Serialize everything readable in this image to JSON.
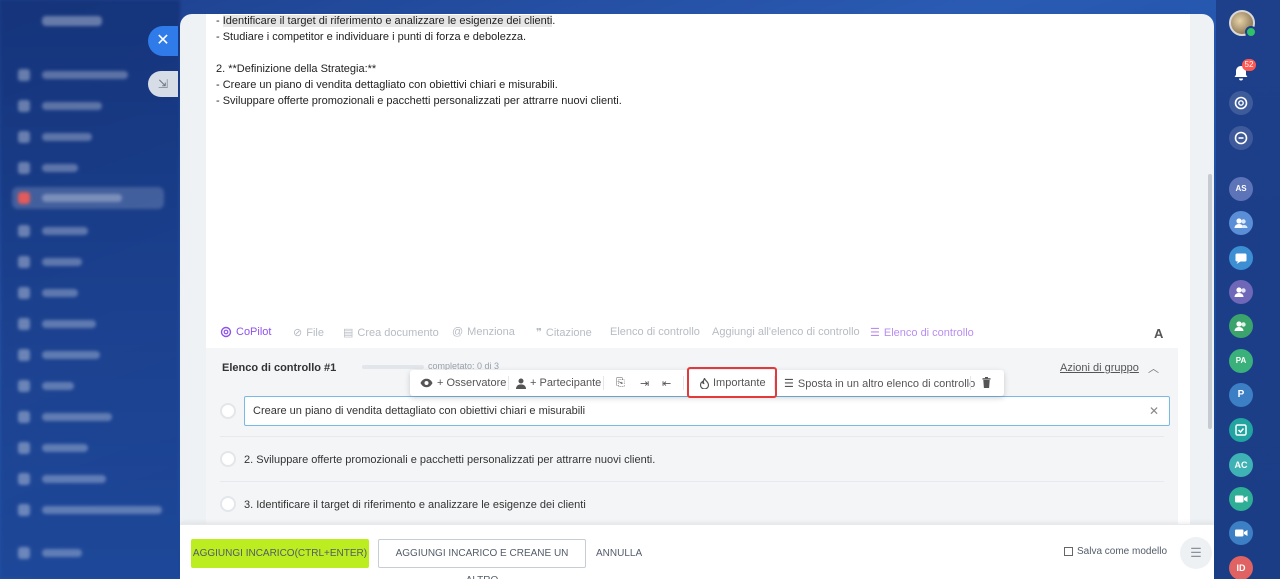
{
  "overlay": {
    "close_icon": "✕",
    "collapse_icon": "⇲"
  },
  "description": {
    "lines": [
      "- Identificare il target di riferimento e analizzare le esigenze dei clienti",
      "- Studiare i competitor e individuare i punti di forza e debolezza.",
      "",
      "2. **Definizione della Strategia:**",
      "- Creare un piano di vendita dettagliato con obiettivi chiari e misurabili.",
      "- Sviluppare offerte promozionali e pacchetti personalizzati per attrarre nuovi clienti."
    ],
    "line0_highlighted": "Identificare il target di riferimento e analizzare le esigenze dei clienti",
    "line0_prefix": "- ",
    "line0_suffix": "."
  },
  "toolbar": {
    "copilot": "CoPilot",
    "file": "File",
    "crea_documento": "Crea documento",
    "menzione": "Menziona",
    "citazione": "Citazione",
    "elenco_controllo": "Elenco di controllo",
    "aggiungi_elenco": "Aggiungi all'elenco di controllo",
    "elenco_controllo_active": "Elenco di controllo",
    "font_button": "A"
  },
  "checklist": {
    "title": "Elenco di controllo #1",
    "completed": "completato: 0 di 3",
    "progress": 0,
    "group_actions": "Azioni di gruppo",
    "editing_item": "Creare un piano di vendita dettagliato con obiettivi chiari e misurabili",
    "items": [
      "2. Sviluppare offerte promozionali e pacchetti personalizzati per attrarre nuovi clienti.",
      "3. Identificare il target di riferimento e analizzare le esigenze dei clienti"
    ]
  },
  "item_popup": {
    "observer": "+ Osservatore",
    "participant": "+ Partecipante",
    "important": "Importante",
    "move": "Sposta in un altro elenco di controllo"
  },
  "footer": {
    "add_task": "AGGIUNGI INCARICO(CTRL+ENTER)",
    "add_and_new": "AGGIUNGI INCARICO E CREANE UN ALTRO",
    "cancel": "ANNULLA",
    "save_template": "Salva come modello"
  },
  "right_sidebar": {
    "notifications_count": "52",
    "avatars": [
      "AS",
      "PA",
      "P",
      "AC",
      "ID"
    ]
  },
  "colors": {
    "accent_green": "#bbed21",
    "copilot_purple": "#8e52ec",
    "highlight_red": "#e23a3a",
    "background_blue": "#2a5bb3"
  }
}
